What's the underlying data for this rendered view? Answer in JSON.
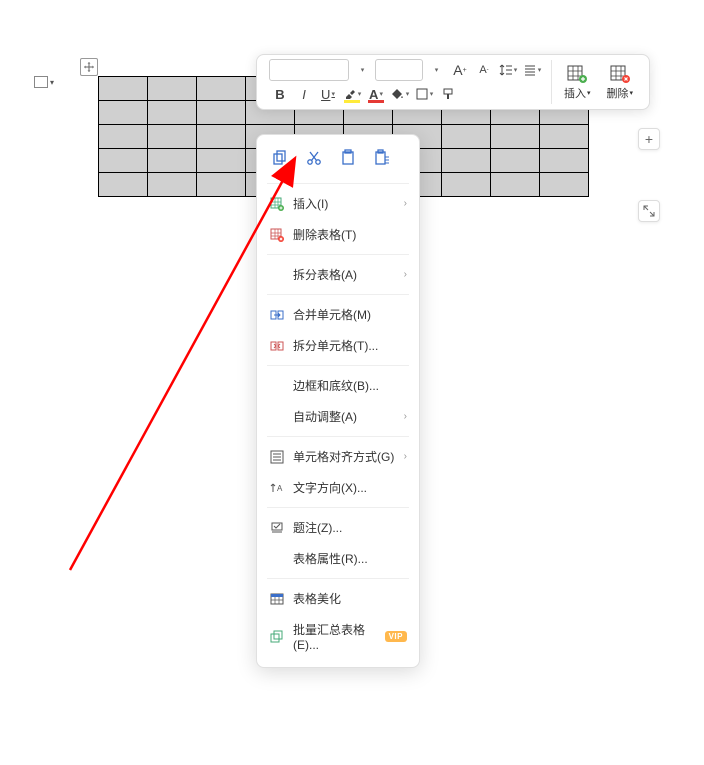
{
  "toolbar": {
    "font_name": "",
    "font_size": "",
    "increase_font": "A",
    "decrease_font": "A",
    "bold": "B",
    "italic": "I",
    "underline": "U",
    "insert_label": "插入",
    "delete_label": "删除"
  },
  "context_menu": {
    "items": [
      {
        "label": "插入(I)",
        "icon": "insert-icon",
        "arrow": true
      },
      {
        "label": "删除表格(T)",
        "icon": "delete-table-icon",
        "arrow": false
      },
      {
        "label": "拆分表格(A)",
        "icon": "",
        "arrow": true,
        "sep_before": true
      },
      {
        "label": "合并单元格(M)",
        "icon": "merge-icon",
        "arrow": false,
        "sep_before": true
      },
      {
        "label": "拆分单元格(T)...",
        "icon": "split-icon",
        "arrow": false
      },
      {
        "label": "边框和底纹(B)...",
        "icon": "",
        "arrow": false,
        "sep_before": true
      },
      {
        "label": "自动调整(A)",
        "icon": "",
        "arrow": true
      },
      {
        "label": "单元格对齐方式(G)",
        "icon": "align-icon",
        "arrow": true,
        "sep_before": true
      },
      {
        "label": "文字方向(X)...",
        "icon": "text-dir-icon",
        "arrow": false
      },
      {
        "label": "题注(Z)...",
        "icon": "caption-icon",
        "arrow": false,
        "sep_before": true
      },
      {
        "label": "表格属性(R)...",
        "icon": "",
        "arrow": false
      },
      {
        "label": "表格美化",
        "icon": "beautify-icon",
        "arrow": false,
        "sep_before": true
      },
      {
        "label": "批量汇总表格(E)...",
        "icon": "batch-icon",
        "arrow": false,
        "vip": true
      }
    ]
  },
  "table": {
    "rows": 5,
    "cols": 10
  },
  "side": {
    "plus": "+"
  }
}
